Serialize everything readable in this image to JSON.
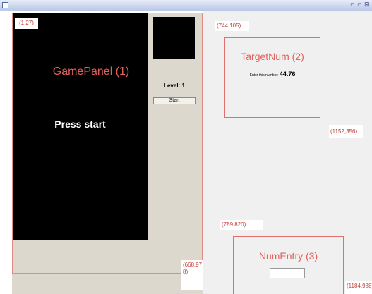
{
  "window": {
    "title_controls": [
      "▫",
      "▫",
      "⊠"
    ]
  },
  "game_panel": {
    "label": "GamePanel  (1)",
    "status_text": "Press start"
  },
  "controls": {
    "level_text": "Level: 1",
    "start_label": "Start"
  },
  "target_num": {
    "label": "TargetNum  (2)",
    "prompt": "Enter this number:",
    "value": "44.76"
  },
  "num_entry": {
    "label": "NumEntry  (3)",
    "input_value": ""
  },
  "annotations": {
    "a1": "(1,27)",
    "a2": "(744,105)",
    "a3": "(1152,356)",
    "a4": "(789,820)",
    "a5": "(668,97\n8)",
    "a6": "(1184,988)"
  }
}
